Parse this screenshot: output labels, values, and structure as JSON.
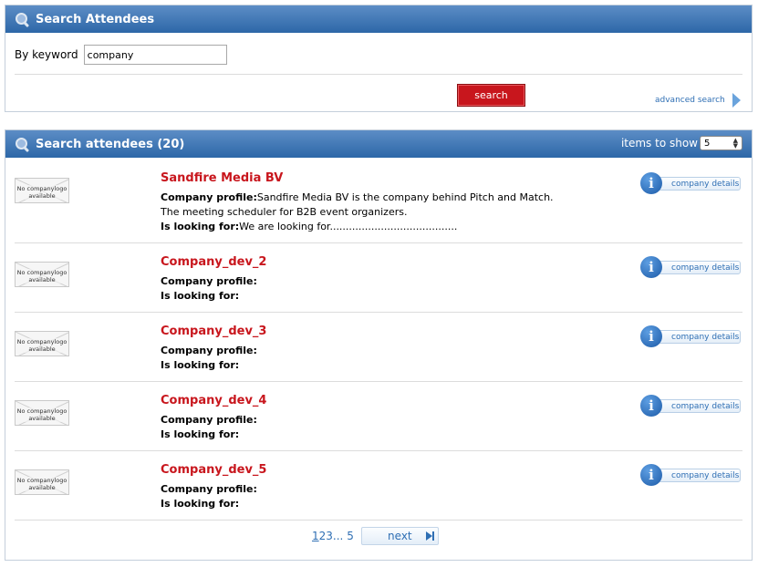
{
  "search_panel": {
    "title": "Search Attendees",
    "keyword_label": "By keyword",
    "keyword_value": "company",
    "search_button": "search",
    "advanced_link": "advanced search"
  },
  "results_panel": {
    "title": "Search attendees (20)",
    "items_label": "items to show",
    "items_value": "5",
    "profile_label": "Company profile:",
    "looking_label": "Is looking for:",
    "details_label": "company details",
    "logo_placeholder": "No companylogo available",
    "results": [
      {
        "name": "Sandfire Media BV",
        "profile": "Sandfire Media BV is the company behind Pitch and Match.",
        "profile_line2": "The meeting scheduler for B2B event organizers.",
        "looking_for": "We are looking for........................................"
      },
      {
        "name": "Company_dev_2",
        "profile": "",
        "looking_for": ""
      },
      {
        "name": "Company_dev_3",
        "profile": "",
        "looking_for": ""
      },
      {
        "name": "Company_dev_4",
        "profile": "",
        "looking_for": ""
      },
      {
        "name": "Company_dev_5",
        "profile": "",
        "looking_for": ""
      }
    ]
  },
  "pagination": {
    "pages": [
      "1",
      "2",
      "3"
    ],
    "ellipsis": "...",
    "last_page": "5",
    "next_label": "next"
  },
  "colors": {
    "header_blue": "#2d67a8",
    "accent_red": "#c8161d",
    "link_blue": "#2f6fb4"
  }
}
